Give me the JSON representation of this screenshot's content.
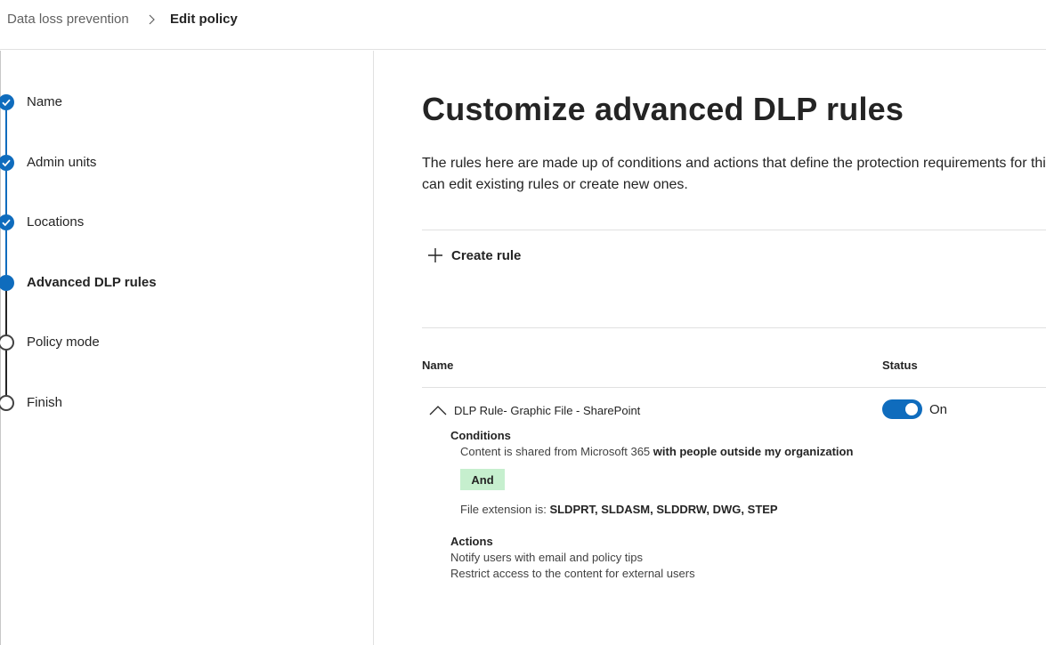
{
  "breadcrumb": {
    "root": "Data loss prevention",
    "current": "Edit policy"
  },
  "steps": [
    {
      "label": "Name",
      "state": "done"
    },
    {
      "label": "Admin units",
      "state": "done"
    },
    {
      "label": "Locations",
      "state": "done"
    },
    {
      "label": "Advanced DLP rules",
      "state": "current"
    },
    {
      "label": "Policy mode",
      "state": "todo"
    },
    {
      "label": "Finish",
      "state": "todo"
    }
  ],
  "main": {
    "title": "Customize advanced DLP rules",
    "description": "The rules here are made up of conditions and actions that define the protection requirements for this policy. You can edit existing rules or create new ones.",
    "create_rule_label": "Create rule",
    "table": {
      "columns": {
        "name": "Name",
        "status": "Status"
      },
      "rule": {
        "name": "DLP Rule- Graphic File - SharePoint",
        "status_label": "On",
        "status_on": true,
        "conditions_title": "Conditions",
        "condition1_prefix": "Content is shared from Microsoft 365 ",
        "condition1_bold": "with people outside my organization",
        "and_label": "And",
        "condition2_prefix": "File extension is: ",
        "condition2_bold": "SLDPRT, SLDASM, SLDDRW, DWG, STEP",
        "actions_title": "Actions",
        "actions": [
          "Notify users with email and policy tips",
          "Restrict access to the content for external users"
        ]
      }
    }
  },
  "colors": {
    "accent": "#0f6cbd",
    "and_badge": "#c6efce"
  }
}
